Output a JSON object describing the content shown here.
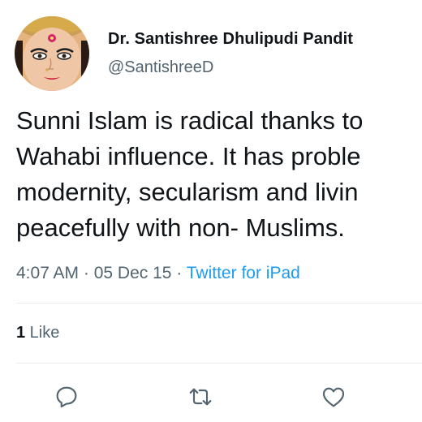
{
  "author": {
    "display_name": "Dr. Santishree Dhulipudi Pandit",
    "handle": "@SantishreeD",
    "avatar_icon": "goddess-durga-avatar"
  },
  "tweet": {
    "lines": [
      "Sunni Islam is radical thanks to",
      "Wahabi influence. It has proble",
      "modernity, secularism and livin",
      "peacefully with non- Muslims."
    ]
  },
  "meta": {
    "time": "4:07 AM",
    "separator": " · ",
    "date": "05 Dec 15",
    "source": "Twitter for iPad"
  },
  "stats": {
    "likes_count": "1",
    "likes_label": " Like"
  },
  "actions": {
    "reply_icon": "reply-icon",
    "retweet_icon": "retweet-icon",
    "like_icon": "heart-icon"
  },
  "colors": {
    "text": "#0f1419",
    "secondary": "#536471",
    "link": "#1d9bf0",
    "divider": "#e6ecf0"
  }
}
